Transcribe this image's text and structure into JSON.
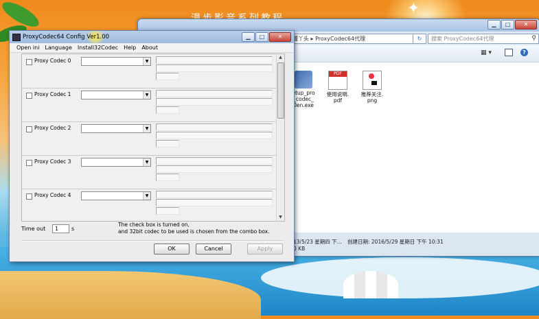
{
  "desktop": {
    "bg_title": "漫步影音系列教程"
  },
  "explorer": {
    "address_text": "懂丫头 ▸ ProxyCodec64代理",
    "search_placeholder": "搜索 ProxyCodec64代理",
    "files": [
      {
        "name": "etup_pro\n_codec_\n0en.exe",
        "icon": "installer-icon"
      },
      {
        "name": "使用说明.\npdf",
        "icon": "pdf-icon"
      },
      {
        "name": "推荐关注.\npng",
        "icon": "image-icon"
      }
    ],
    "details_date_left": "13/5/23 星期四 下...",
    "details_created": "创建日期: 2016/5/29 星期日 下午 10:31",
    "details_size": "0 KB"
  },
  "dialog": {
    "title": "ProxyCodec64 Config Ver1.00",
    "menu": [
      "Open ini",
      "Language",
      "Install32Codec",
      "Help",
      "About"
    ],
    "codecs": [
      {
        "label": "Proxy Codec 0"
      },
      {
        "label": "Proxy Codec 1"
      },
      {
        "label": "Proxy Codec 2"
      },
      {
        "label": "Proxy Codec 3"
      },
      {
        "label": "Proxy Codec 4"
      }
    ],
    "timeout_label": "Time out",
    "timeout_value": "1",
    "timeout_unit": "s",
    "help_line1": "The check box is turned on,",
    "help_line2": "and 32bit codec to be used is chosen from the combo box.",
    "ok_label": "OK",
    "cancel_label": "Cancel",
    "apply_label": "Apply"
  }
}
